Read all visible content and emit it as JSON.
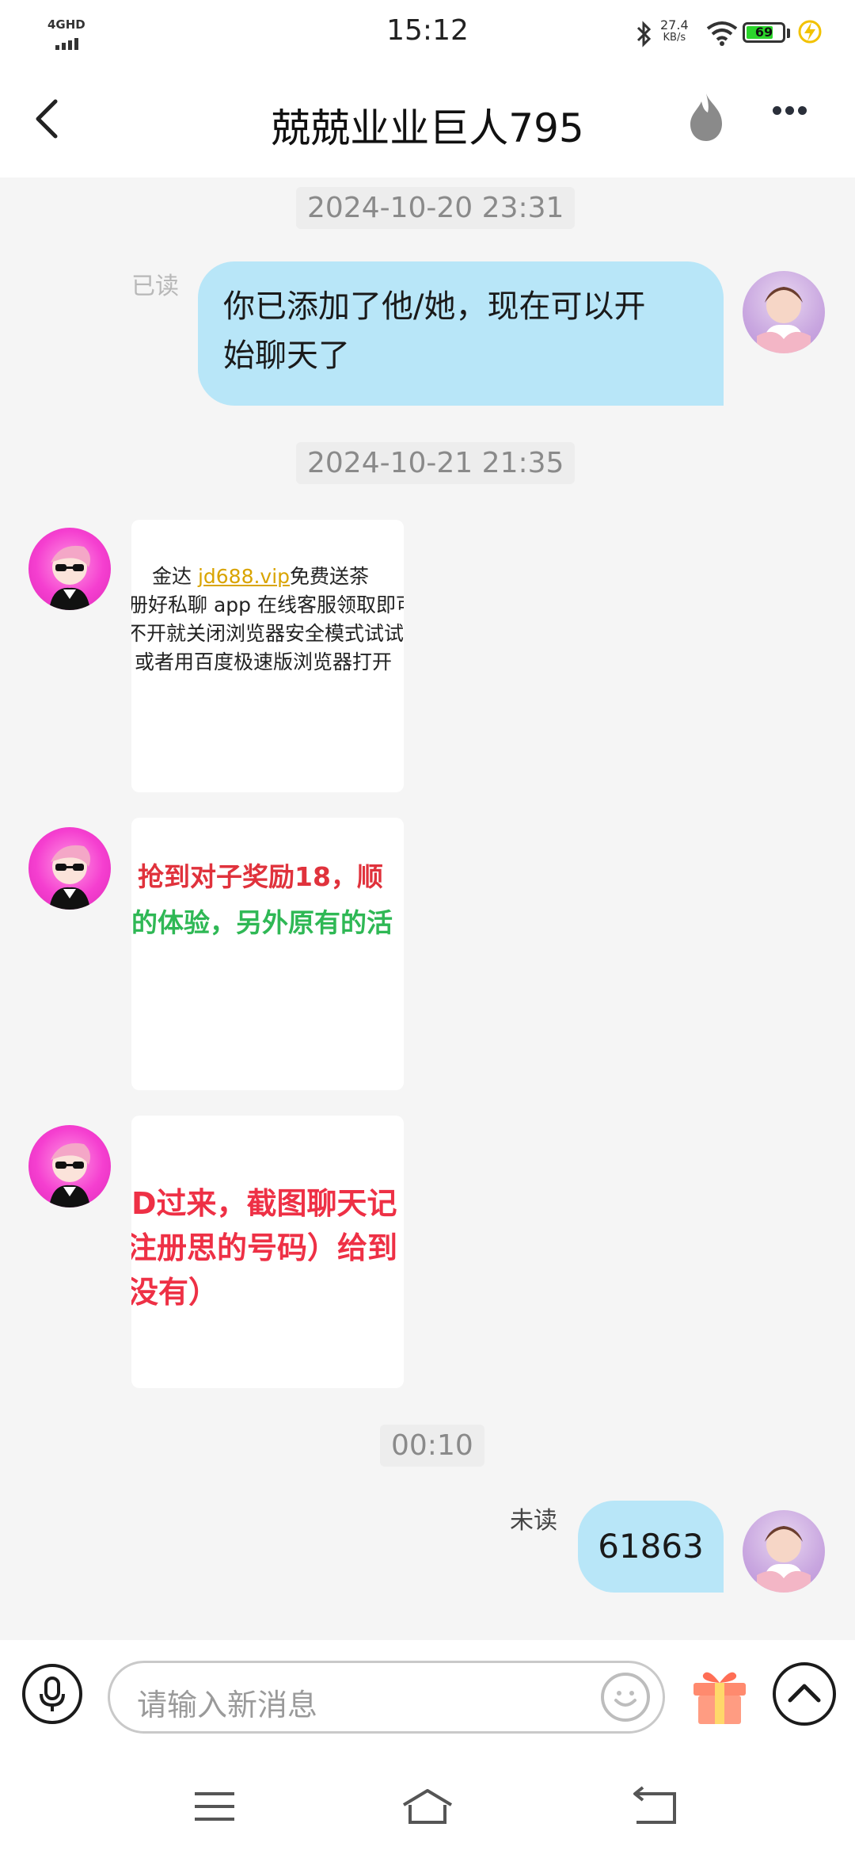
{
  "status_bar": {
    "network": "4GHD",
    "time": "15:12",
    "speed_value": "27.4",
    "speed_unit": "KB/s",
    "battery": "69"
  },
  "header": {
    "title": "兢兢业业巨人795"
  },
  "messages": {
    "ts1": "2024-10-20 23:31",
    "read_label": "已读",
    "msg1_line1": "你已添加了他/她，现在可以开",
    "msg1_line2": "始聊天了",
    "ts2": "2024-10-21 21:35",
    "card1": {
      "line1_prefix": "金达 ",
      "line1_link": "jd688.vip",
      "line1_suffix": "免费送茶",
      "line2": "册好私聊 app 在线客服领取即可",
      "line3": "不开就关闭浏览器安全模式试试",
      "line4": "或者用百度极速版浏览器打开"
    },
    "card2": {
      "line1": "抢到对子奖励18，顺",
      "line2": "的体验，另外原有的活"
    },
    "card3": {
      "line1": "D过来，截图聊天记",
      "line2": "注册思的号码）给到",
      "line3": "没有）"
    },
    "ts3": "00:10",
    "unread_label": "未读",
    "msg2": "61863"
  },
  "input": {
    "placeholder": "请输入新消息"
  },
  "colors": {
    "bubble_out": "#b8e6f8",
    "avatar_other": "#f53fd0",
    "avatar_self": "#c9a7e0",
    "link": "#d9a400"
  },
  "icons": {
    "back": "chevron-left-icon",
    "flame": "flame-icon",
    "more": "more-dots-icon",
    "mic": "microphone-icon",
    "emoji": "smiley-icon",
    "gift": "gift-icon",
    "expand": "chevron-up-icon"
  }
}
